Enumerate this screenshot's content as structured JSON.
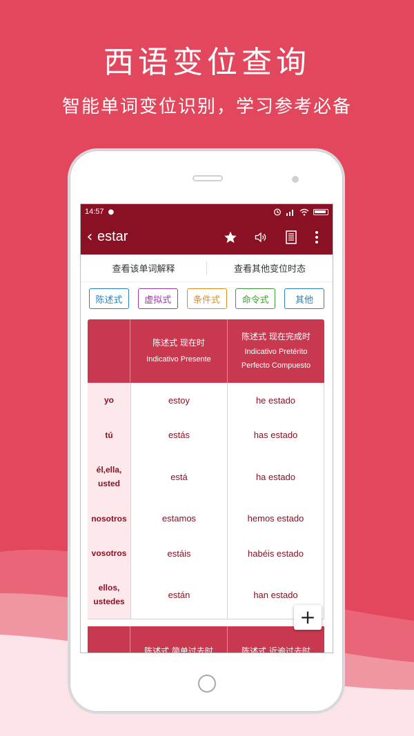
{
  "promo": {
    "title": "西语变位查询",
    "subtitle": "智能单词变位识别，学习参考必备"
  },
  "status_bar": {
    "time": "14:57"
  },
  "toolbar": {
    "back_icon": "chevron-left-icon",
    "word": "estar",
    "actions": [
      "star-icon",
      "speaker-icon",
      "notes-icon",
      "more-vert-icon"
    ]
  },
  "links": {
    "view_definition": "查看该单词解释",
    "view_other_tenses": "查看其他变位时态"
  },
  "moods": [
    {
      "label": "陈述式",
      "color": "#2a7fc1"
    },
    {
      "label": "虚拟式",
      "color": "#9b3aa8"
    },
    {
      "label": "条件式",
      "color": "#e08a1e"
    },
    {
      "label": "命令式",
      "color": "#3f9b3a"
    },
    {
      "label": "其他",
      "color": "#2a7fc1"
    }
  ],
  "table1": {
    "col1_cn": "陈述式 现在时",
    "col1_es": "Indicativo Presente",
    "col2_cn": "陈述式 现在完成时",
    "col2_es_1": "Indicativo Pretérito",
    "col2_es_2": "Perfecto Compuesto",
    "rows": [
      {
        "pronoun_1": "yo",
        "pronoun_2": "",
        "c1": "estoy",
        "c2": "he estado"
      },
      {
        "pronoun_1": "tú",
        "pronoun_2": "",
        "c1": "estás",
        "c2": "has estado"
      },
      {
        "pronoun_1": "él,ella,",
        "pronoun_2": "usted",
        "c1": "está",
        "c2": "ha estado"
      },
      {
        "pronoun_1": "nosotros",
        "pronoun_2": "",
        "c1": "estamos",
        "c2": "hemos estado"
      },
      {
        "pronoun_1": "vosotros",
        "pronoun_2": "",
        "c1": "estáis",
        "c2": "habéis estado"
      },
      {
        "pronoun_1": "ellos,",
        "pronoun_2": "ustedes",
        "c1": "están",
        "c2": "han estado"
      }
    ]
  },
  "table2": {
    "col1_cn": "陈述式 简单过去时",
    "col2_cn": "陈述式 近逾过去时"
  },
  "fab": {
    "icon": "plus-icon",
    "label": "+"
  },
  "colors": {
    "background": "#e2475d",
    "appbar": "#8a1023",
    "table_header": "#c8384e"
  }
}
